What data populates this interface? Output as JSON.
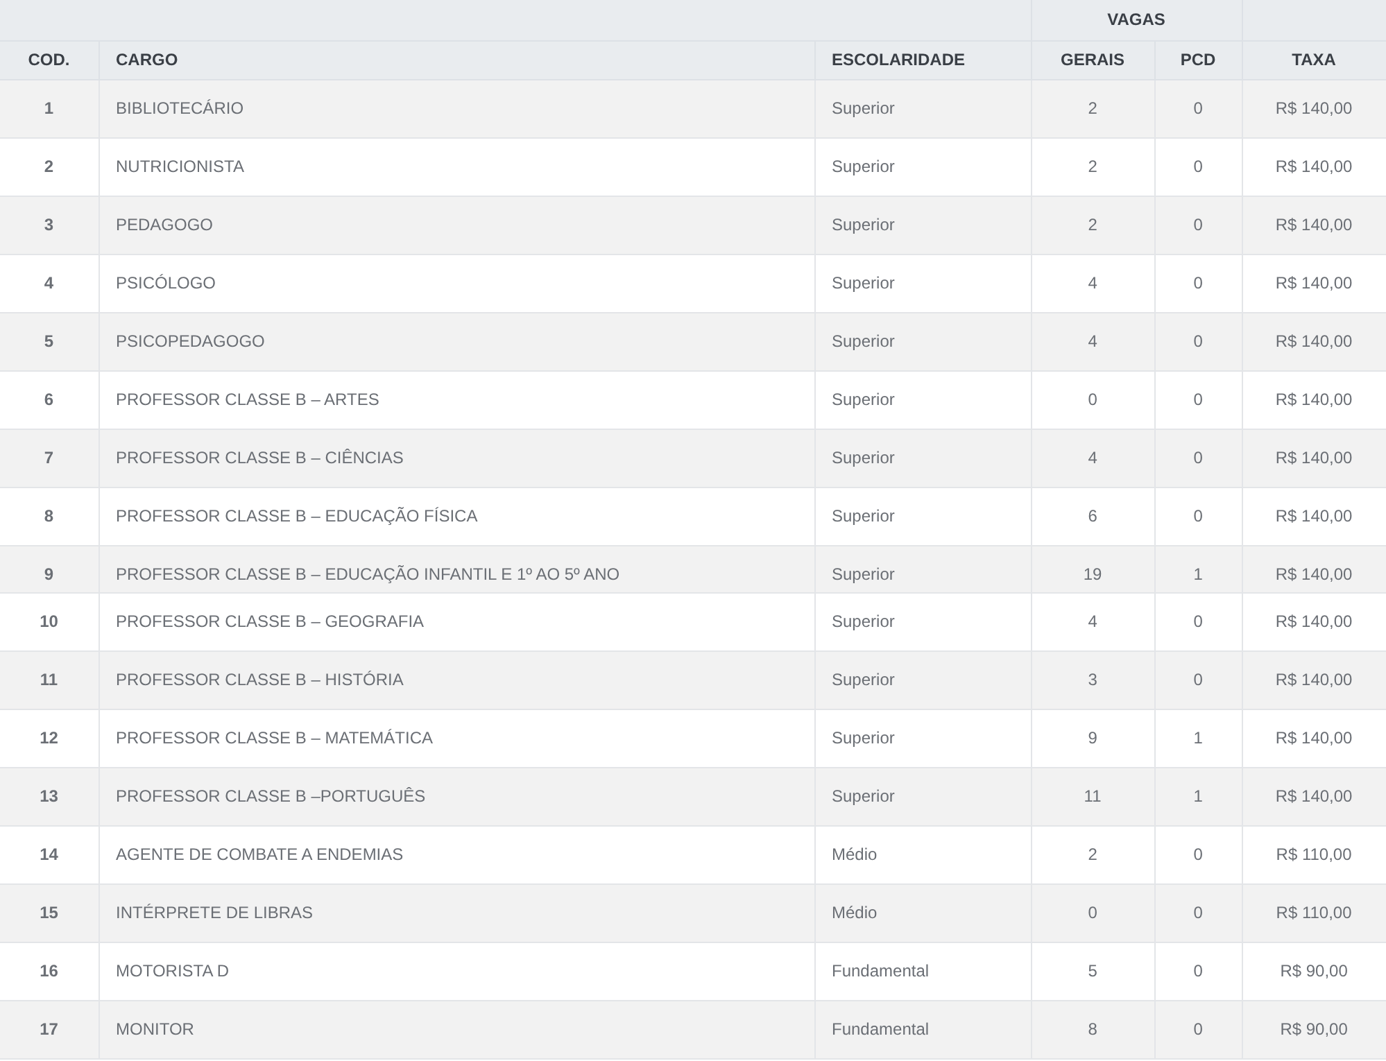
{
  "table": {
    "group_header": "VAGAS",
    "columns": [
      "COD.",
      "CARGO",
      "ESCOLARIDADE",
      "GERAIS",
      "PCD",
      "TAXA"
    ],
    "rows": [
      {
        "cod": "1",
        "cargo": "BIBLIOTECÁRIO",
        "escolaridade": "Superior",
        "gerais": "2",
        "pcd": "0",
        "taxa": "R$ 140,00"
      },
      {
        "cod": "2",
        "cargo": "NUTRICIONISTA",
        "escolaridade": "Superior",
        "gerais": "2",
        "pcd": "0",
        "taxa": "R$ 140,00"
      },
      {
        "cod": "3",
        "cargo": "PEDAGOGO",
        "escolaridade": "Superior",
        "gerais": "2",
        "pcd": "0",
        "taxa": "R$ 140,00"
      },
      {
        "cod": "4",
        "cargo": "PSICÓLOGO",
        "escolaridade": "Superior",
        "gerais": "4",
        "pcd": "0",
        "taxa": "R$ 140,00"
      },
      {
        "cod": "5",
        "cargo": "PSICOPEDAGOGO",
        "escolaridade": "Superior",
        "gerais": "4",
        "pcd": "0",
        "taxa": "R$ 140,00"
      },
      {
        "cod": "6",
        "cargo": "PROFESSOR CLASSE B – ARTES",
        "escolaridade": "Superior",
        "gerais": "0",
        "pcd": "0",
        "taxa": "R$ 140,00"
      },
      {
        "cod": "7",
        "cargo": "PROFESSOR CLASSE B – CIÊNCIAS",
        "escolaridade": "Superior",
        "gerais": "4",
        "pcd": "0",
        "taxa": "R$ 140,00"
      },
      {
        "cod": "8",
        "cargo": "PROFESSOR CLASSE B – EDUCAÇÃO FÍSICA",
        "escolaridade": "Superior",
        "gerais": "6",
        "pcd": "0",
        "taxa": "R$ 140,00"
      },
      {
        "cod": "9",
        "cargo": "PROFESSOR CLASSE B – EDUCAÇÃO INFANTIL E 1º AO 5º ANO",
        "escolaridade": "Superior",
        "gerais": "19",
        "pcd": "1",
        "taxa": "R$ 140,00"
      },
      {
        "cod": "10",
        "cargo": "PROFESSOR CLASSE B – GEOGRAFIA",
        "escolaridade": "Superior",
        "gerais": "4",
        "pcd": "0",
        "taxa": "R$ 140,00"
      },
      {
        "cod": "11",
        "cargo": "PROFESSOR CLASSE B – HISTÓRIA",
        "escolaridade": "Superior",
        "gerais": "3",
        "pcd": "0",
        "taxa": "R$ 140,00"
      },
      {
        "cod": "12",
        "cargo": "PROFESSOR CLASSE B – MATEMÁTICA",
        "escolaridade": "Superior",
        "gerais": "9",
        "pcd": "1",
        "taxa": "R$ 140,00"
      },
      {
        "cod": "13",
        "cargo": "PROFESSOR CLASSE B –PORTUGUÊS",
        "escolaridade": "Superior",
        "gerais": "11",
        "pcd": "1",
        "taxa": "R$ 140,00"
      },
      {
        "cod": "14",
        "cargo": "AGENTE DE COMBATE A ENDEMIAS",
        "escolaridade": "Médio",
        "gerais": "2",
        "pcd": "0",
        "taxa": "R$ 110,00"
      },
      {
        "cod": "15",
        "cargo": "INTÉRPRETE DE LIBRAS",
        "escolaridade": "Médio",
        "gerais": "0",
        "pcd": "0",
        "taxa": "R$ 110,00"
      },
      {
        "cod": "16",
        "cargo": "MOTORISTA D",
        "escolaridade": "Fundamental",
        "gerais": "5",
        "pcd": "0",
        "taxa": "R$ 90,00"
      },
      {
        "cod": "17",
        "cargo": "MONITOR",
        "escolaridade": "Fundamental",
        "gerais": "8",
        "pcd": "0",
        "taxa": "R$ 90,00"
      }
    ]
  }
}
